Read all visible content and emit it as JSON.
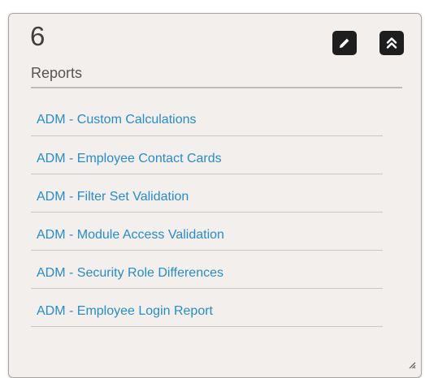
{
  "widget": {
    "count": "6",
    "title": "Reports",
    "edit_icon": "pencil-icon",
    "collapse_icon": "double-chevron-up-icon",
    "resize_icon": "resize-grip-icon"
  },
  "reports": [
    {
      "label": "ADM - Custom Calculations"
    },
    {
      "label": "ADM - Employee Contact Cards"
    },
    {
      "label": "ADM - Filter Set Validation"
    },
    {
      "label": "ADM - Module Access Validation"
    },
    {
      "label": "ADM - Security Role Differences"
    },
    {
      "label": "ADM - Employee Login Report"
    }
  ],
  "colors": {
    "link": "#2a8cc6",
    "panel_background": "#f2efed",
    "button_background": "#1e1e1e"
  }
}
